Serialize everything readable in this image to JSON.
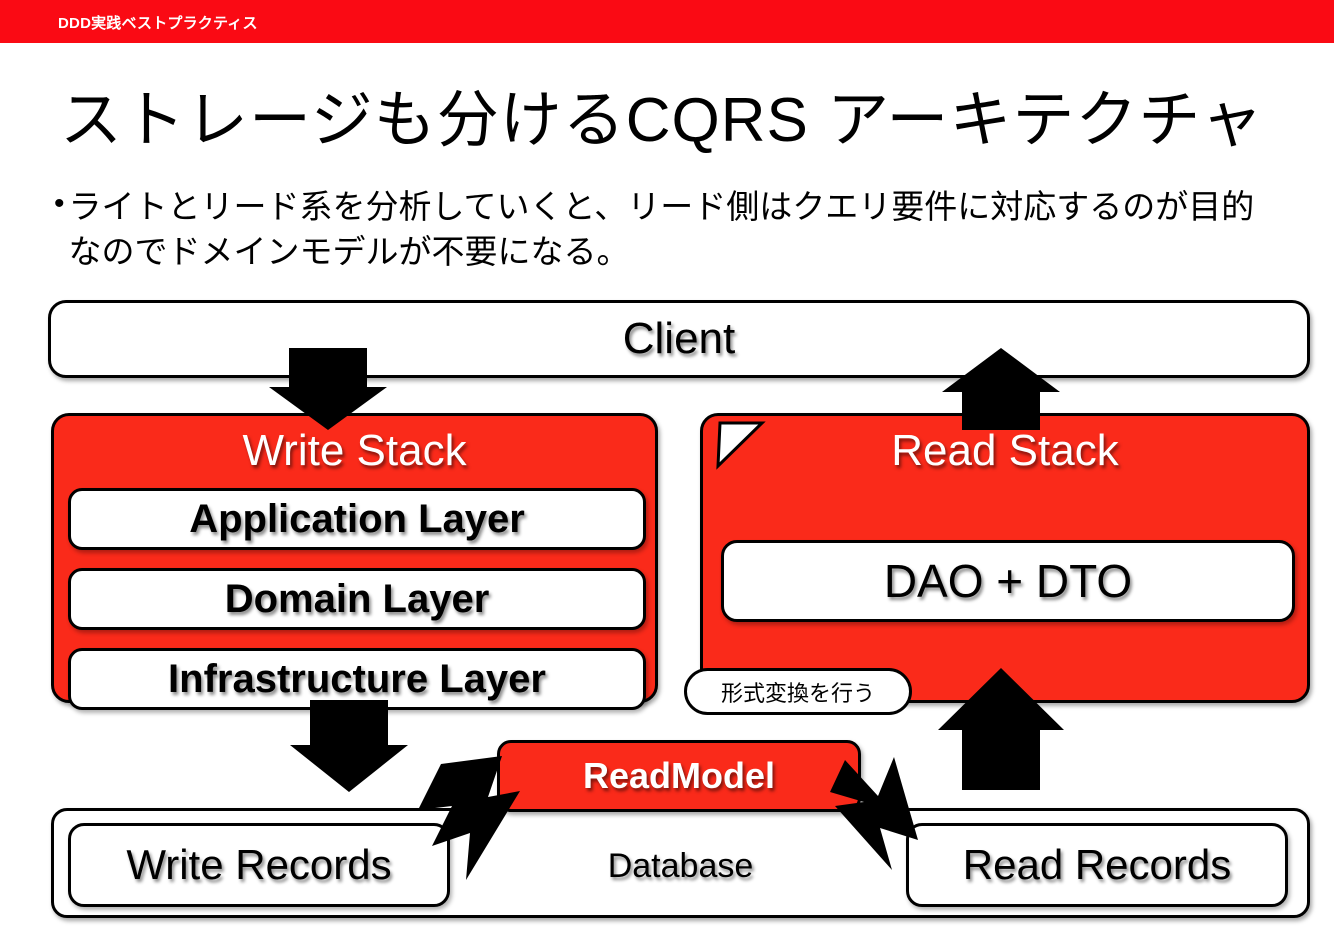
{
  "header": {
    "title": "DDD実践ベストプラクティス",
    "band_color": "#fa0a14"
  },
  "slide": {
    "title": "ストレージも分けるCQRS アーキテクチャ",
    "bullet_marker": "•",
    "bullet_text": "ライトとリード系を分析していくと、リード側はクエリ要件に対応するのが目的なのでドメインモデルが不要になる。"
  },
  "theme": {
    "accent_red": "#fa2a1a",
    "text_black": "#000000",
    "box_white": "#ffffff"
  },
  "diagram": {
    "client": {
      "label": "Client"
    },
    "write_stack": {
      "title": "Write Stack",
      "layers": [
        {
          "label": "Application Layer"
        },
        {
          "label": "Domain Layer"
        },
        {
          "label": "Infrastructure Layer"
        }
      ]
    },
    "read_stack": {
      "title": "Read Stack",
      "components": [
        {
          "label": "DAO + DTO"
        }
      ]
    },
    "callout": {
      "label": "形式変換を行う"
    },
    "read_model": {
      "label": "ReadModel"
    },
    "database": {
      "label": "Database",
      "write_records": {
        "label": "Write Records"
      },
      "read_records": {
        "label": "Read Records"
      }
    },
    "arrows": [
      {
        "name": "client-to-write-stack",
        "direction": "down"
      },
      {
        "name": "read-stack-to-client",
        "direction": "up"
      },
      {
        "name": "write-stack-to-database",
        "direction": "down"
      },
      {
        "name": "read-records-to-read-stack",
        "direction": "up"
      },
      {
        "name": "write-records-to-readmodel",
        "direction": "up-right"
      },
      {
        "name": "readmodel-to-read-records",
        "direction": "down-right"
      }
    ]
  }
}
